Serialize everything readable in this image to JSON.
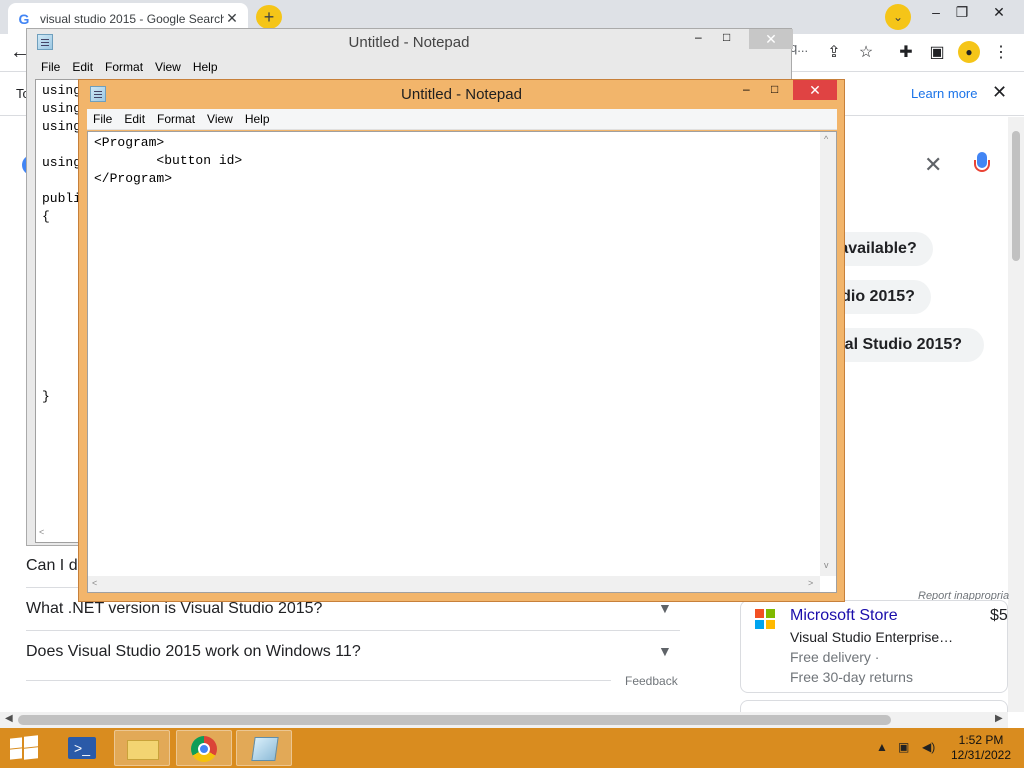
{
  "browser": {
    "tab_title": "visual studio 2015 - Google Search",
    "tab_favicon": "G",
    "new_tab_icon": "+",
    "omnibox_tail": "q...",
    "translate_bar": {
      "left_text": "To",
      "learn_more": "Learn more",
      "close": "✕"
    },
    "search": {
      "clear": "✕"
    },
    "suggestions": [
      "ll available?",
      "tudio 2015?",
      "sual Studio 2015?"
    ],
    "faq": [
      "Can I d",
      "What .NET version is Visual Studio 2015?",
      "Does Visual Studio 2015 work on Windows 11?"
    ],
    "feedback": "Feedback",
    "report": "Report inappropria",
    "shopping": {
      "store": "Microsoft Store",
      "price": "$5",
      "product": "Visual Studio Enterprise…",
      "delivery": "Free delivery ·",
      "returns": "Free 30-day returns"
    }
  },
  "notepad_back": {
    "title": "Untitled - Notepad",
    "menu": [
      "File",
      "Edit",
      "Format",
      "View",
      "Help"
    ],
    "content": "using\nusing\nusing\n\nusing\n\npubli\n{\n\n\n\n\n\n\n\n\n\n}"
  },
  "notepad_front": {
    "title": "Untitled - Notepad",
    "menu": [
      "File",
      "Edit",
      "Format",
      "View",
      "Help"
    ],
    "content": "<Program>\n\t<button id>\n</Program>"
  },
  "taskbar": {
    "apps": [
      "powershell",
      "file-explorer",
      "chrome",
      "notepad"
    ],
    "time": "1:52 PM",
    "date": "12/31/2022"
  },
  "colors": {
    "taskbar": "#d98c1f",
    "active_frame": "#f2b56b",
    "close_button": "#e04343",
    "link": "#1a0dab"
  }
}
